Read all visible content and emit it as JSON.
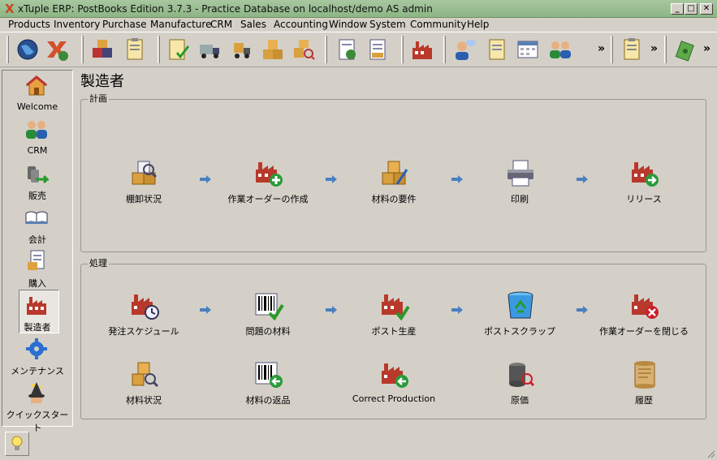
{
  "window": {
    "title": "xTuple ERP: PostBooks Edition 3.7.3 - Practice Database on localhost/demo AS admin",
    "logo": "X",
    "controls": {
      "minimize": "_",
      "maximize": "□",
      "close": "✕"
    }
  },
  "menu": [
    "Products",
    "Inventory",
    "Purchase",
    "Manufacture",
    "CRM",
    "Sales",
    "Accounting",
    "Window",
    "System",
    "Community",
    "Help"
  ],
  "toolbar": {
    "overflow": "»",
    "icons": [
      "globe-icon",
      "xtuple-icon",
      "boxes-icon",
      "clipboard-icon",
      "checklist-icon",
      "truck-icon",
      "forklift-icon",
      "boxes-icon",
      "search-boxes-icon",
      "sheet-icon",
      "sheet-arrow-icon",
      "factory-icon",
      "user-chat-icon",
      "notepad-icon",
      "calendar-icon",
      "users-icon",
      "clipboard-icon",
      "money-icon"
    ]
  },
  "sidebar": [
    {
      "label": "Welcome",
      "icon": "house-icon"
    },
    {
      "label": "CRM",
      "icon": "users-icon"
    },
    {
      "label": "販売",
      "icon": "sales-icon"
    },
    {
      "label": "会計",
      "icon": "book-icon"
    },
    {
      "label": "購入",
      "icon": "document-icon"
    },
    {
      "label": "製造者",
      "icon": "factory-icon"
    },
    {
      "label": "メンテナンス",
      "icon": "gear-icon"
    },
    {
      "label": "クイックスタート",
      "icon": "wizard-icon"
    }
  ],
  "page": {
    "title": "製造者"
  },
  "planning": {
    "label": "計画",
    "items": [
      {
        "label": "棚卸状況",
        "icon": "boxes-search-icon"
      },
      {
        "label": "作業オーダーの作成",
        "icon": "factory-add-icon"
      },
      {
        "label": "材料の要件",
        "icon": "boxes-edit-icon"
      },
      {
        "label": "印刷",
        "icon": "printer-icon"
      },
      {
        "label": "リリース",
        "icon": "factory-release-icon"
      }
    ]
  },
  "processing": {
    "label": "処理",
    "row1": [
      {
        "label": "発注スケジュール",
        "icon": "factory-clock-icon"
      },
      {
        "label": "問題の材料",
        "icon": "barcode-check-icon"
      },
      {
        "label": "ポスト生産",
        "icon": "factory-check-icon"
      },
      {
        "label": "ポストスクラップ",
        "icon": "recycle-bin-icon"
      },
      {
        "label": "作業オーダーを閉じる",
        "icon": "factory-close-icon"
      }
    ],
    "row2": [
      {
        "label": "材料状況",
        "icon": "boxes-search-icon"
      },
      {
        "label": "材料の返品",
        "icon": "barcode-return-icon"
      },
      {
        "label": "Correct Production",
        "icon": "factory-undo-icon"
      },
      {
        "label": "原価",
        "icon": "cost-icon"
      },
      {
        "label": "履歴",
        "icon": "scroll-icon"
      }
    ]
  },
  "status": {
    "icon": "lightbulb-icon"
  }
}
